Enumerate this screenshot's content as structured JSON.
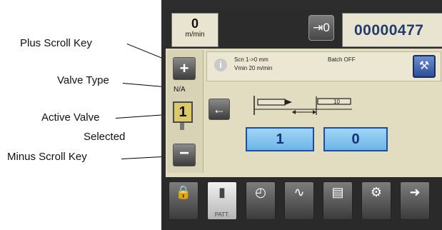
{
  "callouts": {
    "plus_scroll_key": "Plus Scroll Key",
    "valve_type": "Valve Type",
    "active_valve_line1": "Active Valve",
    "active_valve_line2": "Selected",
    "minus_scroll_key": "Minus Scroll Key"
  },
  "header": {
    "speed_value": "0",
    "speed_unit": "m/min",
    "io_label": "⇥0",
    "counter_value": "00000477"
  },
  "valve": {
    "type": "N/A",
    "active_number": "1"
  },
  "info": {
    "line1": "Scn 1->0 mm",
    "line2": "Vmin 20 m/min",
    "batch": "Batch OFF"
  },
  "pattern": {
    "label": "10"
  },
  "fields": {
    "value1": "1",
    "value2": "0"
  },
  "tabs": [
    {
      "label": "",
      "icon": "lock-icon"
    },
    {
      "label": "PATT.",
      "icon": "pattern-icon"
    },
    {
      "label": "",
      "icon": "gauge-icon"
    },
    {
      "label": "",
      "icon": "wave-icon"
    },
    {
      "label": "",
      "icon": "io-icon"
    },
    {
      "label": "",
      "icon": "gear-icon"
    },
    {
      "label": "",
      "icon": "arrow-right-icon"
    }
  ]
}
